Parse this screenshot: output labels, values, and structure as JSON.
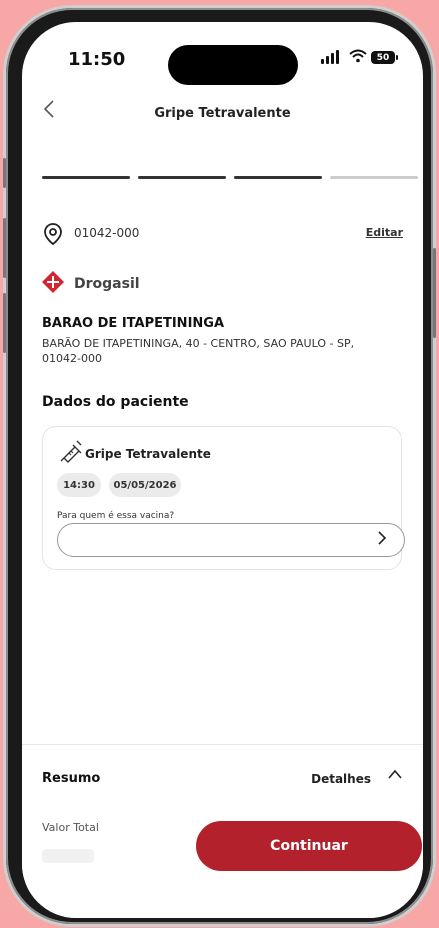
{
  "status_bar": {
    "time": "11:50",
    "battery": "50"
  },
  "header": {
    "title": "Gripe Tetravalente",
    "back_icon": "chevron-left-icon"
  },
  "progress": {
    "steps_total": 4,
    "steps_complete": 3,
    "active_color": "#333333",
    "inactive_color": "#cccccc"
  },
  "address": {
    "cep": "01042-000",
    "edit_label": "Editar"
  },
  "pharmacy": {
    "brand": "Drogasil",
    "brand_color": "#d12631",
    "store_name": "BARAO DE ITAPETININGA",
    "store_address": "BARÃO DE ITAPETININGA, 40  - CENTRO, SAO PAULO - SP, 01042-000"
  },
  "patient_section": {
    "title": "Dados do paciente",
    "card": {
      "vaccine": "Gripe Tetravalente",
      "time": "14:30",
      "date": "05/05/2026",
      "question_label": "Para quem é essa vacina?",
      "selected_value": ""
    }
  },
  "footer": {
    "summary_label": "Resumo",
    "details_label": "Detalhes",
    "total_label": "Valor Total",
    "cta_label": "Continuar",
    "cta_color": "#b3212c"
  }
}
